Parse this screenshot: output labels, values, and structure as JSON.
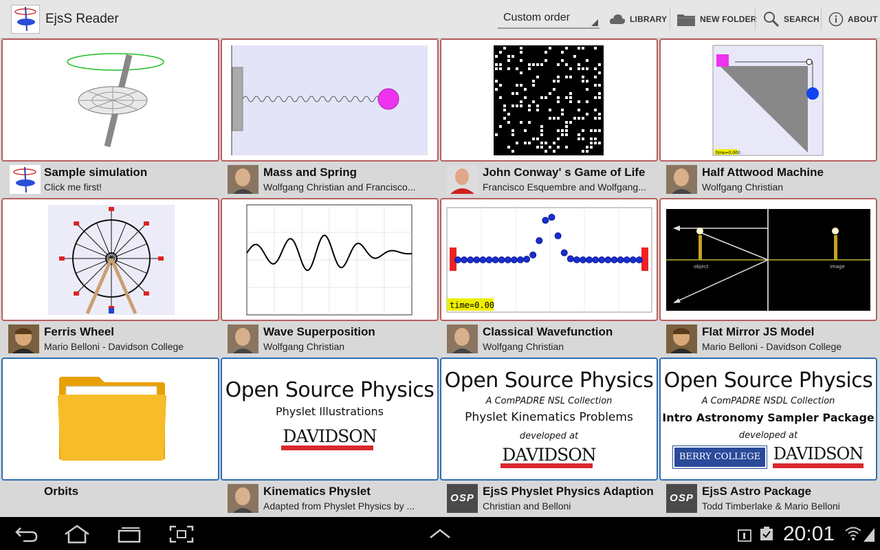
{
  "app": {
    "title": "EjsS Reader",
    "sort": {
      "selected": "Custom order"
    },
    "actions": {
      "library": "LIBRARY",
      "new_folder": "NEW FOLDER",
      "search": "SEARCH",
      "about": "ABOUT"
    }
  },
  "items": [
    {
      "title": "Sample simulation",
      "subtitle": "Click me first!",
      "avatar": "ejss-icon"
    },
    {
      "title": "Mass and Spring",
      "subtitle": "Wolfgang Christian and Francisco...",
      "avatar": "author-photo"
    },
    {
      "title": "John Conway' s Game of Life",
      "subtitle": "Francisco Esquembre and Wolfgang...",
      "avatar": "author-photo"
    },
    {
      "title": "Half Attwood Machine",
      "subtitle": "Wolfgang Christian",
      "avatar": "author-photo"
    },
    {
      "title": "Ferris Wheel",
      "subtitle": "Mario Belloni - Davidson College",
      "avatar": "author-photo"
    },
    {
      "title": "Wave Superposition",
      "subtitle": "Wolfgang Christian",
      "avatar": "author-photo"
    },
    {
      "title": "Classical Wavefunction",
      "subtitle": "Wolfgang Christian",
      "avatar": "author-photo",
      "thumb_label": "time=0.00"
    },
    {
      "title": "Flat Mirror JS Model",
      "subtitle": "Mario Belloni - Davidson College",
      "avatar": "author-photo",
      "thumb_labels": [
        "object",
        "image"
      ]
    },
    {
      "title": "Orbits",
      "subtitle": "",
      "avatar": ""
    },
    {
      "title": "Kinematics Physlet",
      "subtitle": "Adapted from Physlet Physics by ...",
      "avatar": "author-photo"
    },
    {
      "title": "EjsS Physlet Physics Adaption",
      "subtitle": "Christian and Belloni",
      "avatar": "osp-logo"
    },
    {
      "title": "EjsS Astro Package",
      "subtitle": "Todd Timberlake & Mario Belloni",
      "avatar": "osp-logo"
    }
  ],
  "thumbs": {
    "attwood_label": "time=0.000",
    "osp1": {
      "title": "Open Source Physics",
      "line1": "Physlet Illustrations",
      "logo": "DAVIDSON"
    },
    "osp2": {
      "title": "Open Source Physics",
      "line1": "A ComPADRE NSL Collection",
      "line2": "Physlet Kinematics Problems",
      "line3": "developed at",
      "logo": "DAVIDSON"
    },
    "osp3": {
      "title": "Open Source Physics",
      "line1": "A ComPADRE NSDL Collection",
      "line2": "Intro Astronomy Sampler Package",
      "line3": "developed at",
      "logo1": "BERRY COLLEGE",
      "logo2": "DAVIDSON"
    },
    "osp_badge": "OSP"
  },
  "statusbar": {
    "time": "20:01"
  },
  "colors": {
    "accent_red": "#b7605f",
    "accent_blue": "#2e6fb3"
  }
}
